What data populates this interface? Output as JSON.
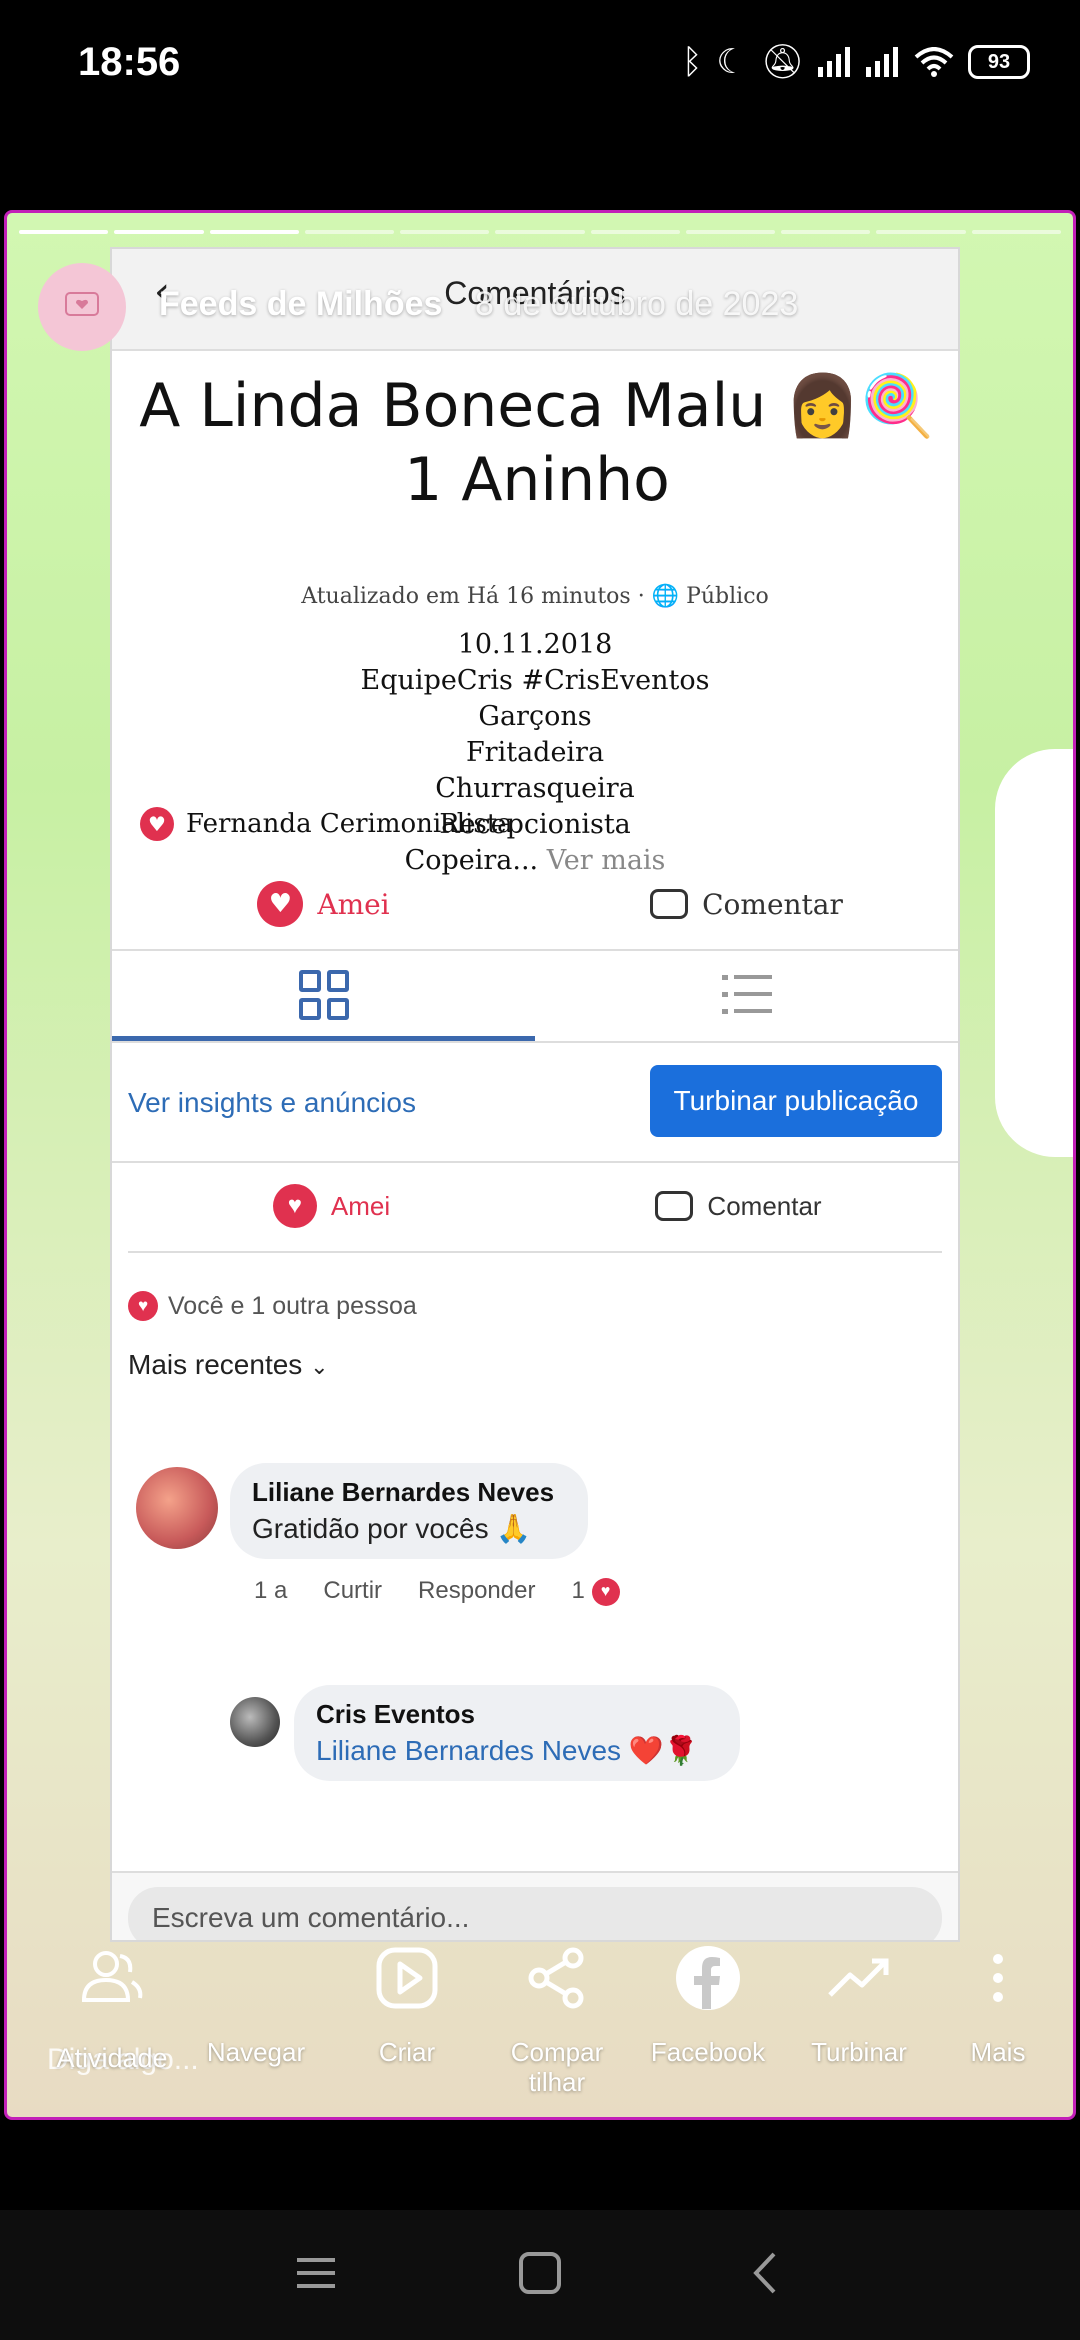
{
  "status_bar": {
    "time": "18:56",
    "icons": [
      "bluetooth-icon",
      "moon-icon",
      "bell-off-icon",
      "signal-icon",
      "signal-icon",
      "wifi-icon"
    ],
    "battery": "93"
  },
  "story": {
    "page_name": "Feeds de Milhões",
    "date": "8 de outubro de 2023",
    "progress_segments": 11,
    "progress_done": 3,
    "reply_placeholder": "Diga algo..."
  },
  "card": {
    "header_title": "Comentários",
    "back_icon": "‹",
    "post_title": "A Linda Boneca Malu 👩🍭 1 Aninho",
    "meta": "Atualizado em Há 16 minutos · 🌐 Público",
    "body_lines": [
      "10.11.2018",
      "EquipeCris #CrisEventos",
      "Garçons",
      "Fritadeira",
      "Churrasqueira",
      "Recepcionista"
    ],
    "body_last": "Copeira...",
    "see_more": "Ver mais",
    "reactor": "Fernanda Cerimonialista",
    "love_label": "Amei",
    "comment_label": "Comentar",
    "insights_link": "Ver insights e anúncios",
    "boost_button": "Turbinar publicação",
    "love_label_2": "Amei",
    "comment_label_2": "Comentar",
    "likes_summary": "Você e 1 outra pessoa",
    "sort_label": "Mais recentes",
    "comments": [
      {
        "name": "Liliane Bernardes Neves",
        "text": "Gratidão por vocês 🙏",
        "age": "1 a",
        "like": "Curtir",
        "reply": "Responder",
        "reactions": "1"
      },
      {
        "name": "Cris Eventos",
        "text": "Liliane Bernardes Neves ❤️🌹"
      }
    ],
    "composer_placeholder": "Escreva um comentário..."
  },
  "actions": [
    {
      "label": "Atividade",
      "icon": "people-icon"
    },
    {
      "label": "Navegar",
      "icon": ""
    },
    {
      "label": "Criar",
      "icon": "play-icon"
    },
    {
      "label": "Compar tilhar",
      "icon": "share-icon"
    },
    {
      "label": "Facebook",
      "icon": "facebook-icon"
    },
    {
      "label": "Turbinar",
      "icon": "trend-icon"
    },
    {
      "label": "Mais",
      "icon": "more-vertical-icon"
    }
  ],
  "colors": {
    "accent_blue": "#1b6fdc",
    "love_red": "#e0314f",
    "frame_magenta": "#c21fb8"
  }
}
